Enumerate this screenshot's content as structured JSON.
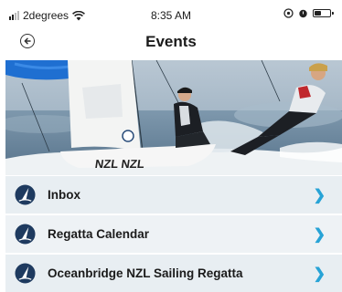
{
  "status_bar": {
    "carrier": "2degrees",
    "time": "8:35 AM",
    "battery_level": 0.45,
    "signal_bars_filled": 2
  },
  "header": {
    "title": "Events",
    "back_icon": "back-arrow-circle-icon"
  },
  "hero": {
    "sail_text": "NZL NZL",
    "description_colors": {
      "sky": "#9fb3c4",
      "sea": "#6f8ea6",
      "spinnaker": "#1f6fd1"
    }
  },
  "list": {
    "items": [
      {
        "label": "Inbox",
        "icon": "sailboat-logo-icon"
      },
      {
        "label": "Regatta Calendar",
        "icon": "sailboat-logo-icon"
      },
      {
        "label": "Oceanbridge NZL Sailing Regatta",
        "icon": "sailboat-logo-icon"
      }
    ],
    "chevron_icon": "chevron-right-icon"
  },
  "colors": {
    "accent": "#27a3d6",
    "logo_navy": "#1e3a5f",
    "row_bg": "#e8eef2"
  }
}
